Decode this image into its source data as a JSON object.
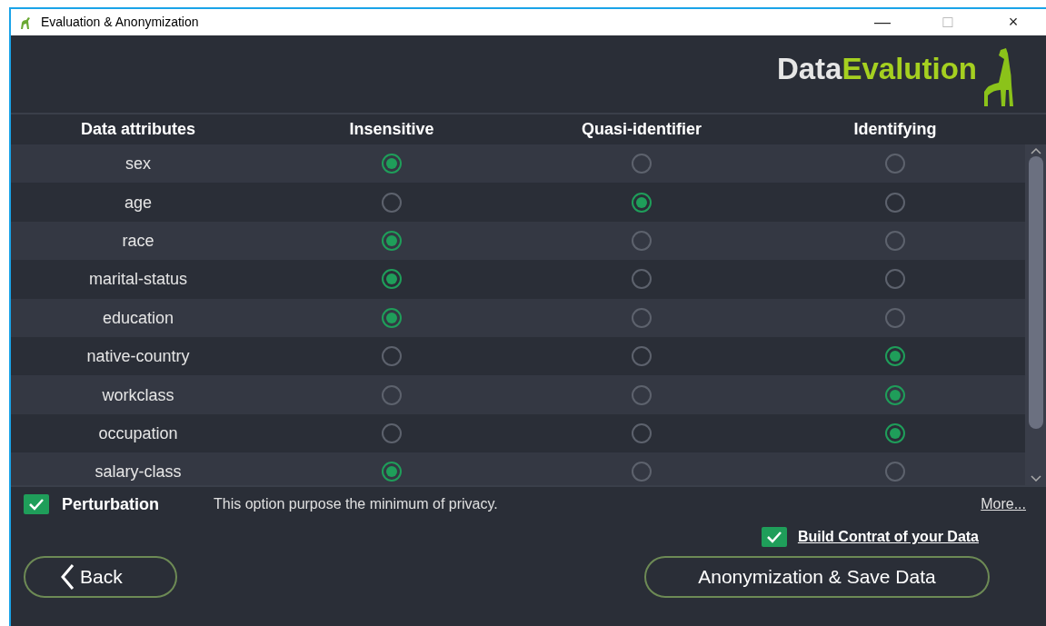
{
  "window": {
    "title": "Evaluation & Anonymization",
    "controls": [
      "—",
      "□",
      "×"
    ]
  },
  "logo": {
    "part_1": "Data",
    "part_2": "Evalution"
  },
  "table": {
    "columns": [
      "Data attributes",
      "Insensitive",
      "Quasi-identifier",
      "Identifying"
    ],
    "rows": [
      {
        "attribute": "sex",
        "options": [
          {
            "selected": true
          },
          {
            "selected": false
          },
          {
            "selected": false
          }
        ]
      },
      {
        "attribute": "age",
        "options": [
          {
            "selected": false
          },
          {
            "selected": true
          },
          {
            "selected": false
          }
        ]
      },
      {
        "attribute": "race",
        "options": [
          {
            "selected": true
          },
          {
            "selected": false
          },
          {
            "selected": false
          }
        ]
      },
      {
        "attribute": "marital-status",
        "options": [
          {
            "selected": true
          },
          {
            "selected": false
          },
          {
            "selected": false
          }
        ]
      },
      {
        "attribute": "education",
        "options": [
          {
            "selected": true
          },
          {
            "selected": false
          },
          {
            "selected": false
          }
        ]
      },
      {
        "attribute": "native-country",
        "options": [
          {
            "selected": false
          },
          {
            "selected": false
          },
          {
            "selected": true
          }
        ]
      },
      {
        "attribute": "workclass",
        "options": [
          {
            "selected": false
          },
          {
            "selected": false
          },
          {
            "selected": true
          }
        ]
      },
      {
        "attribute": "occupation",
        "options": [
          {
            "selected": false
          },
          {
            "selected": false
          },
          {
            "selected": true
          }
        ]
      },
      {
        "attribute": "salary-class",
        "options": [
          {
            "selected": true
          },
          {
            "selected": false
          },
          {
            "selected": false
          }
        ]
      }
    ]
  },
  "perturbation": {
    "label": "Perturbation",
    "checked": true,
    "description": "This option purpose the minimum of privacy.",
    "more_link": "More..."
  },
  "contrast": {
    "label": "Build Contrat of your Data",
    "checked": true
  },
  "buttons": {
    "back": "Back",
    "save": "Anonymization & Save Data"
  }
}
